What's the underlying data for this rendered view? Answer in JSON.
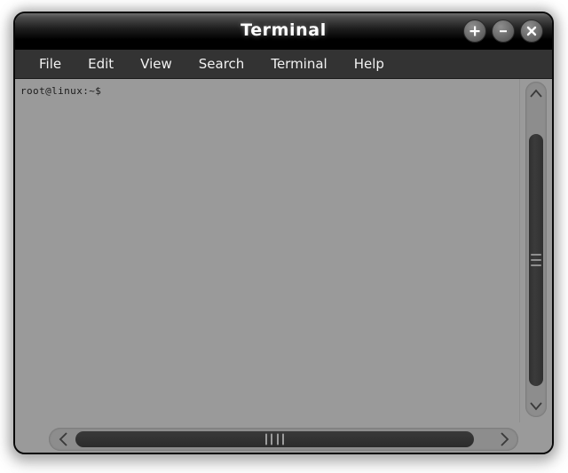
{
  "window": {
    "title": "Terminal",
    "buttons": [
      {
        "name": "maximize-button",
        "icon": "plus-icon",
        "label": "+"
      },
      {
        "name": "minimize-button",
        "icon": "minus-icon",
        "label": "−"
      },
      {
        "name": "close-button",
        "icon": "close-icon",
        "label": "×"
      }
    ]
  },
  "menubar": {
    "items": [
      {
        "label": "File"
      },
      {
        "label": "Edit"
      },
      {
        "label": "View"
      },
      {
        "label": "Search"
      },
      {
        "label": "Terminal"
      },
      {
        "label": "Help"
      }
    ]
  },
  "terminal": {
    "prompt": "root@linux:~$",
    "lines": [
      "root@linux:~$"
    ],
    "background_color": "#9a9a9a",
    "text_color": "#1c1c1c"
  },
  "scrollbars": {
    "vertical": {
      "up_icon": "chevron-up-icon",
      "down_icon": "chevron-down-icon",
      "grip_lines": 3
    },
    "horizontal": {
      "left_icon": "chevron-left-icon",
      "right_icon": "chevron-right-icon",
      "grip_lines": 4
    }
  },
  "colors": {
    "titlebar": "#000000",
    "menubar": "#333333",
    "body": "#9a9a9a",
    "border": "#090909",
    "thumb": "#333333"
  }
}
